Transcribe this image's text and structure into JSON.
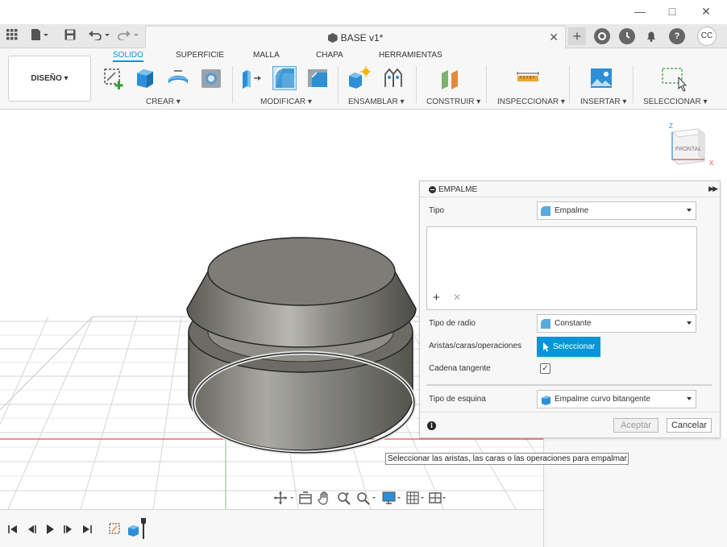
{
  "document": {
    "title": "BASE v1*"
  },
  "account": {
    "initials": "CC"
  },
  "workspace": {
    "label": "DISEÑO"
  },
  "ribbon": {
    "tabs": [
      "SOLIDO",
      "SUPERFICIE",
      "MALLA",
      "CHAPA",
      "HERRAMIENTAS"
    ],
    "active_tab": "SOLIDO",
    "groups": {
      "crear": "CREAR",
      "modificar": "MODIFICAR",
      "ensamblar": "ENSAMBLAR",
      "construir": "CONSTRUIR",
      "inspeccionar": "INSPECCIONAR",
      "insertar": "INSERTAR",
      "seleccionar": "SELECCIONAR"
    }
  },
  "viewcube": {
    "face": "FRONTAL",
    "axis_z": "Z",
    "axis_x": "X"
  },
  "panel": {
    "title": "EMPALME",
    "tipo_label": "Tipo",
    "tipo_value": "Empalme",
    "tipo_radio_label": "Tipo de radio",
    "tipo_radio_value": "Constante",
    "aristas_label": "Aristas/caras/operaciones",
    "select_button": "Seleccionar",
    "cadena_label": "Cadena tangente",
    "cadena_checked": "✓",
    "esquina_label": "Tipo de esquina",
    "esquina_value": "Empalme curvo bitangente",
    "ok_button": "Aceptar",
    "cancel_button": "Cancelar"
  },
  "tooltip": "Seleccionar las aristas, las caras o las operaciones para empalmar",
  "colors": {
    "accent": "#0696d7",
    "axis_red": "#e0504a",
    "axis_green": "#7ab36b"
  }
}
